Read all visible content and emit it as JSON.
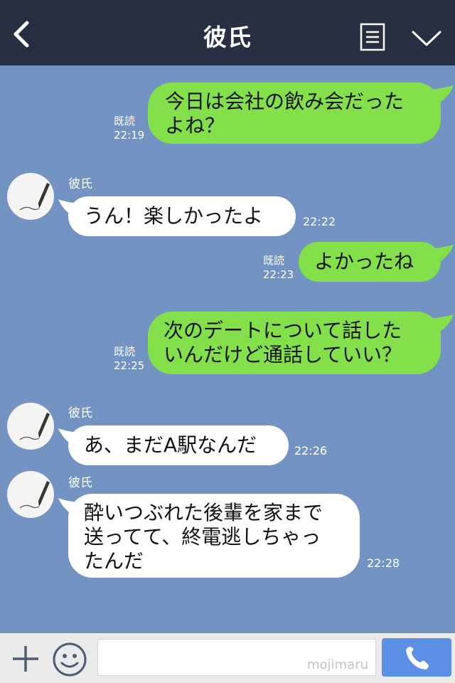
{
  "header": {
    "title": "彼氏"
  },
  "contact": {
    "name": "彼氏"
  },
  "messages": [
    {
      "direction": "outgoing",
      "text": "今日は会社の飲み会だった\nよね？",
      "read_label": "既読",
      "time": "22:19"
    },
    {
      "direction": "incoming",
      "sender": "彼氏",
      "text": "うん！楽しかったよ",
      "time": "22:22"
    },
    {
      "direction": "outgoing",
      "text": "よかったね",
      "read_label": "既読",
      "time": "22:23"
    },
    {
      "direction": "outgoing",
      "text": "次のデートについて話した\nいんだけど通話していい？",
      "read_label": "既読",
      "time": "22:25"
    },
    {
      "direction": "incoming",
      "sender": "彼氏",
      "text": "あ、まだA駅なんだ",
      "time": "22:26"
    },
    {
      "direction": "incoming",
      "sender": "彼氏",
      "text": "酔いつぶれた後輩を家まで\n送ってて、終電逃しちゃっ\nたんだ",
      "time": "22:28"
    }
  ],
  "footer": {
    "input_placeholder": "",
    "watermark": "mojimaru"
  },
  "icons": {
    "back": "back-chevron-icon",
    "menu": "menu-list-icon",
    "collapse": "chevron-down-icon",
    "add": "plus-icon",
    "sticker": "smiley-icon",
    "call": "phone-icon"
  },
  "colors": {
    "header_bg": "#263042",
    "chat_bg": "#7393c2",
    "outgoing_bubble": "#84e04a",
    "incoming_bubble": "#ffffff",
    "call_button": "#5c8fe6"
  }
}
